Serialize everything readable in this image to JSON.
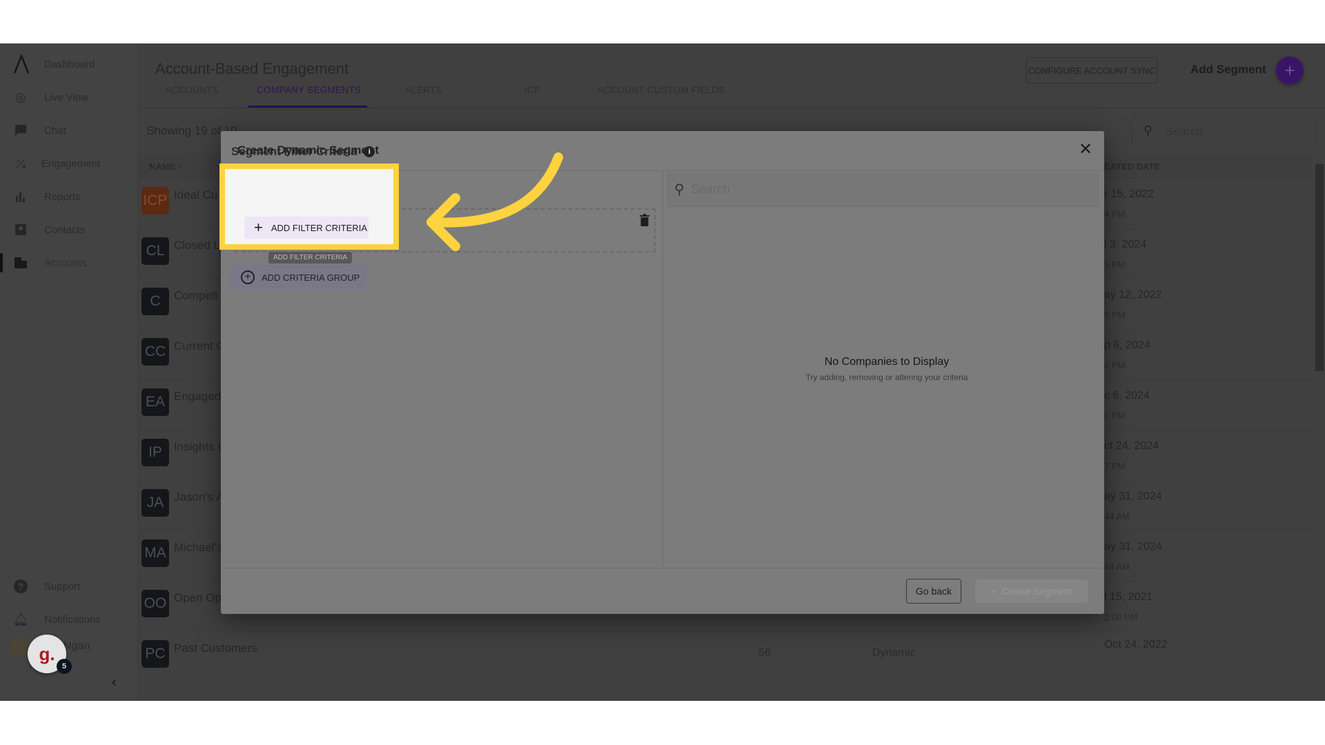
{
  "sidebar": {
    "items": [
      {
        "label": "Dashboard",
        "icon": "logo-icon"
      },
      {
        "label": "Live View",
        "icon": "globe-search-icon"
      },
      {
        "label": "Chat",
        "icon": "chat-icon"
      },
      {
        "label": "Engagement",
        "icon": "engagement-icon"
      },
      {
        "label": "Reports",
        "icon": "bar-chart-icon"
      },
      {
        "label": "Contacts",
        "icon": "contacts-icon"
      },
      {
        "label": "Accounts",
        "icon": "building-icon"
      }
    ],
    "support": "Support",
    "notifications": "Notifications",
    "user_name": "Ngan",
    "guidde_letter": "g.",
    "guidde_badge": "5"
  },
  "header": {
    "title": "Account-Based Engagement",
    "configure_sync": "CONFIGURE ACCOUNT SYNC",
    "add_segment": "Add Segment",
    "accent": "#3a1466"
  },
  "tabs": [
    {
      "label": "ACCOUNTS",
      "active": false
    },
    {
      "label": "COMPANY SEGMENTS",
      "active": true
    },
    {
      "label": "ALERTS",
      "active": false
    },
    {
      "label": "ICP",
      "active": false
    },
    {
      "label": "ACCOUNT CUSTOM FIELDS",
      "active": false
    }
  ],
  "list": {
    "showing": "Showing 19 of 19",
    "search_placeholder": "Search",
    "col_name": "NAME ↑",
    "col_created": "EATED DATE",
    "rows": [
      {
        "initials": "ICP",
        "name": "Ideal Cu",
        "date": "r 15, 2022",
        "time": "4 PM",
        "highlight": true
      },
      {
        "initials": "CL",
        "name": "Closed L",
        "date": "l 3, 2024",
        "time": "5 PM"
      },
      {
        "initials": "C",
        "name": "Competi",
        "date": "ay 12, 2022",
        "time": "8 PM"
      },
      {
        "initials": "CC",
        "name": "Current C",
        "date": "p 6, 2024",
        "time": "6 PM"
      },
      {
        "initials": "EA",
        "name": "Engaged",
        "date": "c 6, 2024",
        "time": "0 PM"
      },
      {
        "initials": "IP",
        "name": "Insights I",
        "date": "ct 24, 2024",
        "time": "7 PM"
      },
      {
        "initials": "JA",
        "name": "Jason's A",
        "date": "ay 31, 2024",
        "time": "44 AM"
      },
      {
        "initials": "MA",
        "name": "Michael's",
        "date": "ay 31, 2024",
        "time": "44 AM"
      },
      {
        "initials": "OO",
        "name": "Open Op",
        "date": "l 15, 2021",
        "time": "2:00 PM"
      },
      {
        "initials": "PC",
        "name": "Past Customers",
        "count": "56",
        "type": "Dynamic",
        "date": "Oct 24, 2022",
        "time": ""
      }
    ]
  },
  "modal": {
    "title": "Create Dynamic Segment",
    "criteria_title": "Segment Filter Criteria",
    "add_filter": "ADD FILTER CRITERIA",
    "tooltip": "ADD FILTER CRITERIA",
    "add_group": "ADD CRITERIA GROUP",
    "search_placeholder": "Search",
    "empty_title": "No Companies to Display",
    "empty_sub": "Try adding, removing or altering your criteria",
    "go_back": "Go back",
    "create": "Create Segment",
    "highlight_color": "#ffd23f"
  }
}
